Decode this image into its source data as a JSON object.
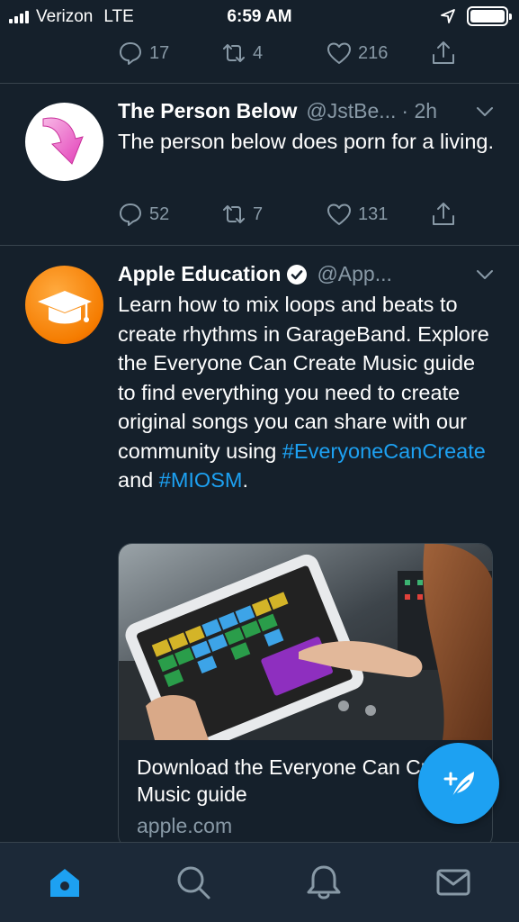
{
  "status_bar": {
    "carrier": "Verizon",
    "network": "LTE",
    "time": "6:59 AM"
  },
  "top_tweet_actions": {
    "replies": "17",
    "retweets": "4",
    "likes": "216"
  },
  "tweets": [
    {
      "name": "The Person Below",
      "handle": "@JstBe...",
      "time": "· 2h",
      "text": "The person below does porn for a living.",
      "replies": "52",
      "retweets": "7",
      "likes": "131",
      "avatar_icon": "pink-arrow-icon"
    },
    {
      "name": "Apple Education",
      "handle": "@App...",
      "verified": true,
      "text_parts": {
        "main": "Learn how to mix loops and beats to create rhythms in GarageBand. Explore the Everyone Can Create Music guide to find everything you need to create original songs you can share with our community using ",
        "hashtag1": "#EveryoneCanCreate",
        "and": " and ",
        "hashtag2": "#MIOSM",
        "end": "."
      },
      "avatar_icon": "graduation-cap-icon",
      "card": {
        "title": "Download the Everyone Can Create Music guide",
        "domain": "apple.com"
      }
    }
  ],
  "colors": {
    "background": "#15202b",
    "accent": "#1da1f2",
    "muted": "#8899a6",
    "divider": "#38444d"
  }
}
